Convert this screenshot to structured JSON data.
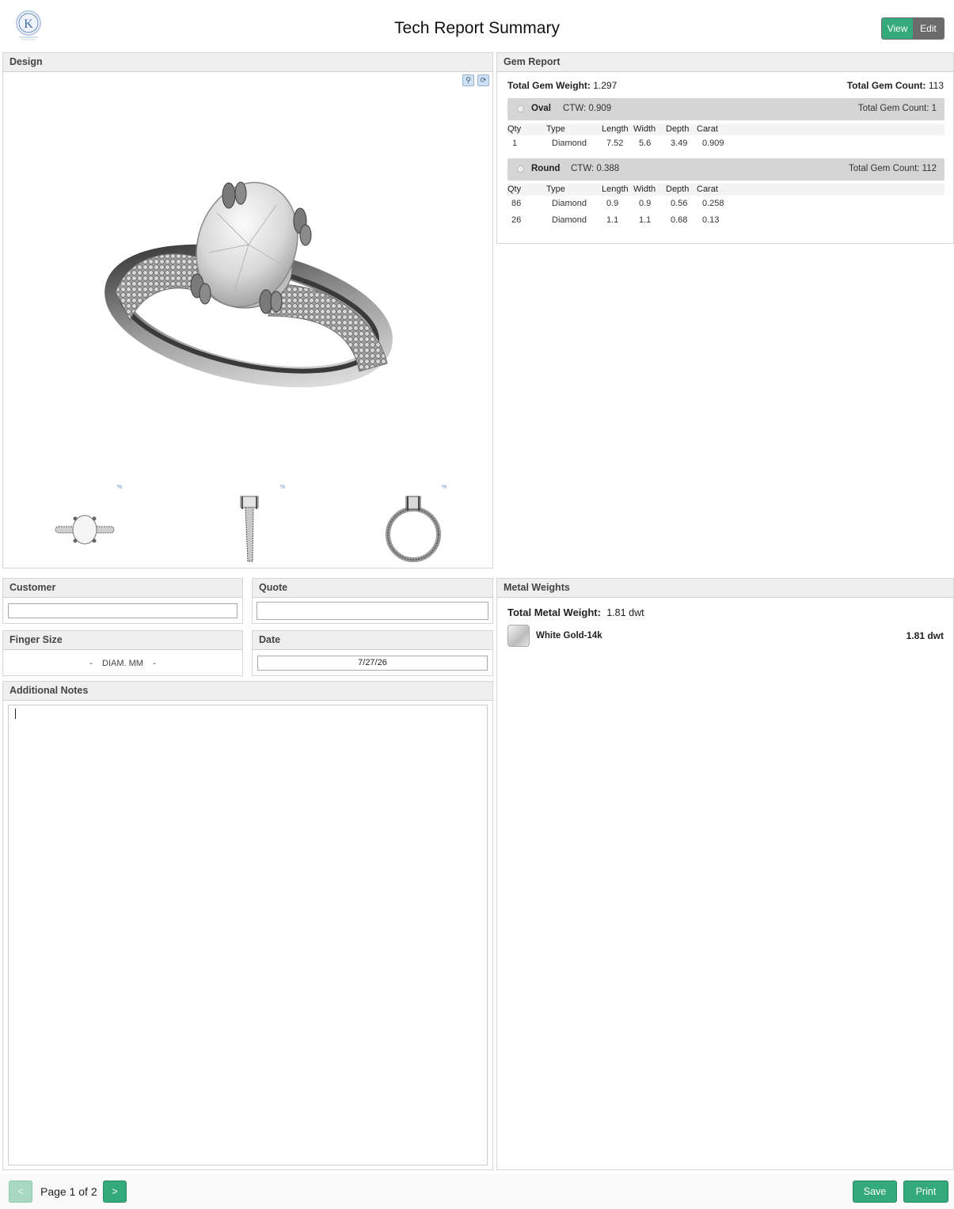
{
  "header": {
    "title": "Tech Report Summary",
    "logo_letter": "K",
    "view_label": "View",
    "edit_label": "Edit"
  },
  "design": {
    "title": "Design",
    "thumb_tags": [
      "%",
      "%",
      "%"
    ]
  },
  "gem_report": {
    "title": "Gem Report",
    "total_weight_label": "Total Gem Weight:",
    "total_weight": "1.297",
    "total_count_label": "Total Gem Count:",
    "total_count": "113",
    "columns": [
      "Qty",
      "Type",
      "Length",
      "Width",
      "Depth",
      "Carat"
    ],
    "groups": [
      {
        "shape": "Oval",
        "ctw": "CTW: 0.909",
        "count": "Total Gem Count:  1",
        "rows": [
          {
            "qty": "1",
            "type": "Diamond",
            "length": "7.52",
            "width": "5.6",
            "depth": "3.49",
            "carat": "0.909"
          }
        ]
      },
      {
        "shape": "Round",
        "ctw": "CTW: 0.388",
        "count": "Total Gem Count:  112",
        "rows": [
          {
            "qty": "86",
            "type": "Diamond",
            "length": "0.9",
            "width": "0.9",
            "depth": "0.56",
            "carat": "0.258"
          },
          {
            "qty": "26",
            "type": "Diamond",
            "length": "1.1",
            "width": "1.1",
            "depth": "0.68",
            "carat": "0.13"
          }
        ]
      }
    ]
  },
  "customer": {
    "title": "Customer",
    "value": ""
  },
  "quote": {
    "title": "Quote",
    "value": ""
  },
  "finger_size": {
    "title": "Finger Size",
    "left": "-",
    "unit": "DIAM. MM",
    "right": "-"
  },
  "date": {
    "title": "Date",
    "value": "7/27/26"
  },
  "notes": {
    "title": "Additional Notes",
    "value": ""
  },
  "metal": {
    "title": "Metal Weights",
    "total_label": "Total Metal Weight:",
    "total_value": "1.81",
    "total_unit": "dwt",
    "name": "White Gold-14k",
    "value": "1.81 dwt"
  },
  "footer": {
    "prev_label": "<",
    "next_label": ">",
    "page_label": "Page 1 of 2",
    "save_label": "Save",
    "print_label": "Print"
  },
  "colors": {
    "accent": "#34a97a",
    "toggle_off": "#6b6b6b",
    "panel_header": "#efefef",
    "gem_group_bg": "#d5d5d5"
  }
}
